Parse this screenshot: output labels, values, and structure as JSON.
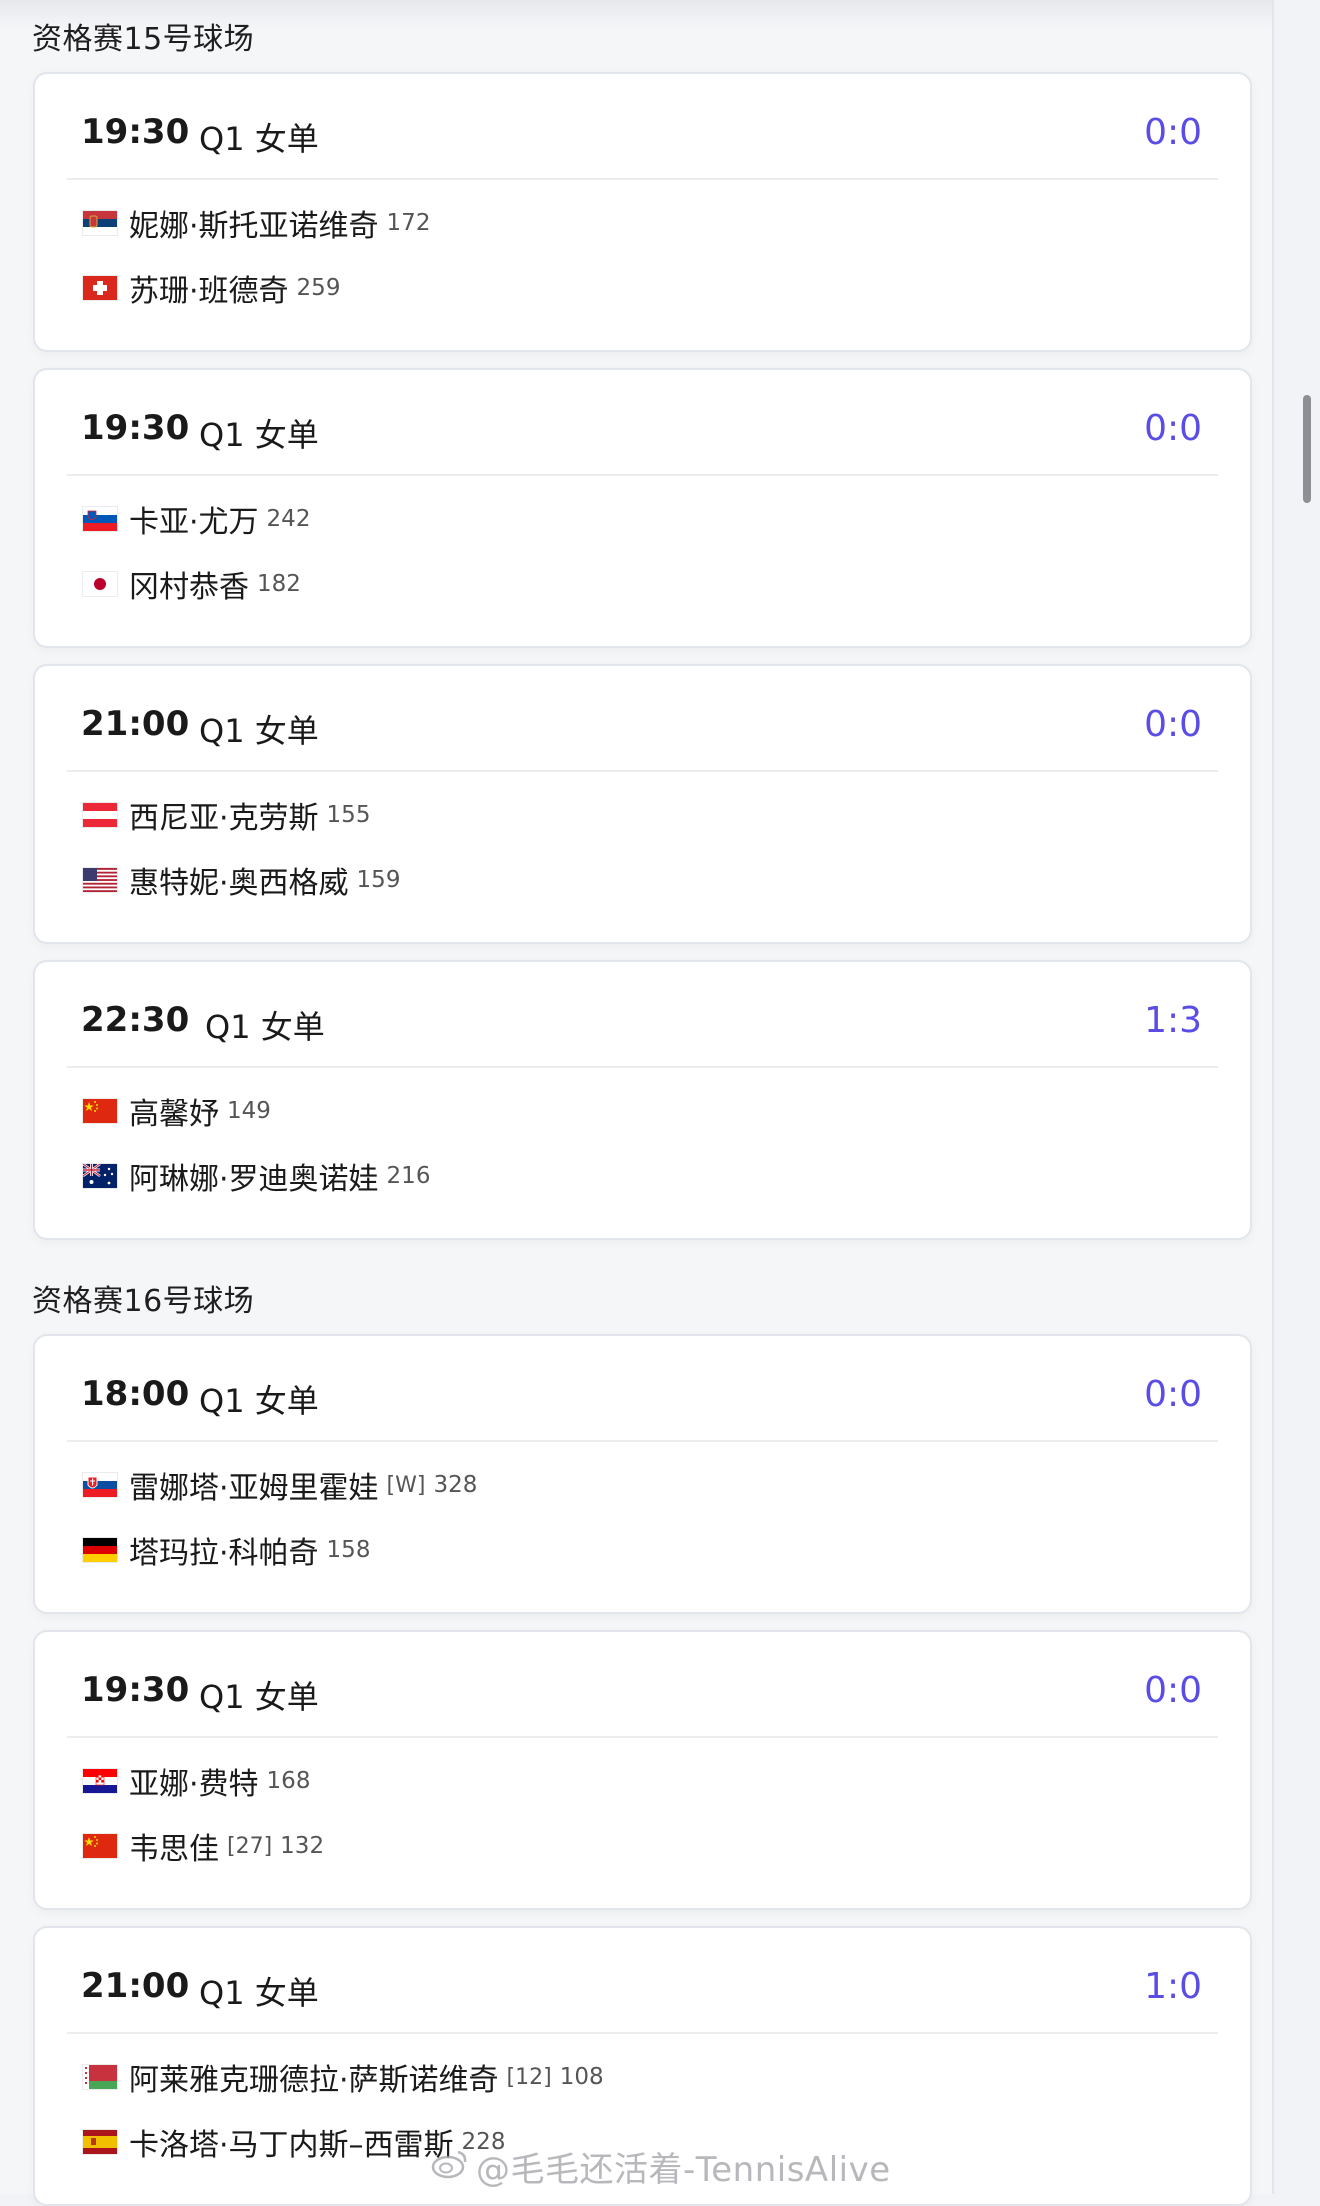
{
  "sections": [
    {
      "title": "资格赛15号球场",
      "matches": [
        {
          "time": "19:30",
          "round": "Q1 女单",
          "score": "0:0",
          "players": [
            {
              "flag": "flag-serbia",
              "name": "妮娜·斯托亚诺维奇",
              "seed": "",
              "rank": "172"
            },
            {
              "flag": "flag-switzerland",
              "name": "苏珊·班德奇",
              "seed": "",
              "rank": "259"
            }
          ]
        },
        {
          "time": "19:30",
          "round": "Q1 女单",
          "score": "0:0",
          "players": [
            {
              "flag": "flag-slovenia",
              "name": "卡亚·尤万",
              "seed": "",
              "rank": "242"
            },
            {
              "flag": "flag-japan",
              "name": "冈村恭香",
              "seed": "",
              "rank": "182"
            }
          ]
        },
        {
          "time": "21:00",
          "round": "Q1 女单",
          "score": "0:0",
          "players": [
            {
              "flag": "flag-austria",
              "name": "西尼亚·克劳斯",
              "seed": "",
              "rank": "155"
            },
            {
              "flag": "flag-usa",
              "name": "惠特妮·奥西格威",
              "seed": "",
              "rank": "159"
            }
          ]
        },
        {
          "time": "22:30",
          "round": "Q1 女单",
          "score": "1:3",
          "players": [
            {
              "flag": "flag-china",
              "name": "高馨妤",
              "seed": "",
              "rank": "149"
            },
            {
              "flag": "flag-australia",
              "name": "阿琳娜·罗迪奥诺娃",
              "seed": "",
              "rank": "216"
            }
          ]
        }
      ]
    },
    {
      "title": "资格赛16号球场",
      "matches": [
        {
          "time": "18:00",
          "round": "Q1 女单",
          "score": "0:0",
          "players": [
            {
              "flag": "flag-slovakia",
              "name": "雷娜塔·亚姆里霍娃",
              "seed": "[W]",
              "rank": "328"
            },
            {
              "flag": "flag-germany",
              "name": "塔玛拉·科帕奇",
              "seed": "",
              "rank": "158"
            }
          ]
        },
        {
          "time": "19:30",
          "round": "Q1 女单",
          "score": "0:0",
          "players": [
            {
              "flag": "flag-croatia",
              "name": "亚娜·费特",
              "seed": "",
              "rank": "168"
            },
            {
              "flag": "flag-china",
              "name": "韦思佳",
              "seed": "[27]",
              "rank": "132"
            }
          ]
        },
        {
          "time": "21:00",
          "round": "Q1 女单",
          "score": "1:0",
          "players": [
            {
              "flag": "flag-belarus",
              "name": "阿莱雅克珊德拉·萨斯诺维奇",
              "seed": "[12]",
              "rank": "108"
            },
            {
              "flag": "flag-spain",
              "name": "卡洛塔·马丁内斯–西雷斯",
              "seed": "",
              "rank": "228"
            }
          ]
        }
      ]
    }
  ],
  "watermark": "@毛毛还活着-TennisAlive",
  "colors": {
    "score": "#5a4de6",
    "card_border": "#e2e5eb",
    "background": "#f5f6f8"
  }
}
